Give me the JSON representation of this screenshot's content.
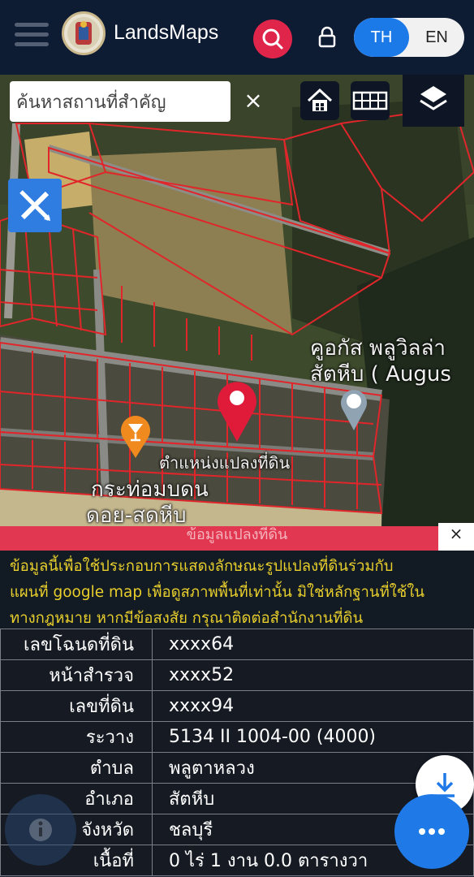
{
  "header": {
    "brand": "LandsMaps",
    "lang_th": "TH",
    "lang_en": "EN"
  },
  "map": {
    "search_placeholder": "ค้นหาสถานที่สำคัญ",
    "clear_label": "×",
    "place_name_line1": "คูอกัส พลูวิลล่า",
    "place_name_line2": "สัตหีบ ( Augus",
    "pin_label": "ตำแหน่งแปลงที่ดิน",
    "poi_line1": "กระท่อมบดน",
    "poi_line2": "ดอย-สดหีบ"
  },
  "panel": {
    "title": "ข้อมูลแปลงที่ดิน",
    "close_label": "×",
    "notice_lines": [
      "ข้อมูลนี้เพื่อใช้ประกอบการแสดงลักษณะรูปแปลงที่ดินร่วมกับ",
      "แผนที่ google map เพื่อดูสภาพพื้นที่เท่านั้น มิใช่หลักฐานที่ใช้ใน",
      "ทางกฎหมาย หากมีข้อสงสัย กรุณาติดต่อสำนักงานที่ดิน"
    ],
    "rows": [
      {
        "label": "เลขโฉนดที่ดิน",
        "value": "xxxx64"
      },
      {
        "label": "หน้าสำรวจ",
        "value": "xxxx52"
      },
      {
        "label": "เลขที่ดิน",
        "value": "xxxx94"
      },
      {
        "label": "ระวาง",
        "value": "5134 II 1004-00 (4000)"
      },
      {
        "label": "ตำบล",
        "value": "พลูตาหลวง"
      },
      {
        "label": "อำเภอ",
        "value": "สัตหีบ"
      },
      {
        "label": "จังหวัด",
        "value": "ชลบุรี"
      },
      {
        "label": "เนื้อที่",
        "value": "0 ไร่ 1 งาน 0.0 ตารางวา"
      }
    ]
  },
  "icons": {
    "menu": "hamburger-icon",
    "search": "search-icon",
    "lock": "lock-icon",
    "home": "home-icon",
    "grid": "grid-icon",
    "layers": "layers-icon",
    "tools": "ruler-pencil-icon",
    "pin": "map-pin-icon",
    "poi": "cocktail-icon",
    "download": "download-icon",
    "more": "more-dots-icon",
    "info": "info-icon"
  },
  "colors": {
    "header_bg": "#0d1b33",
    "accent_red": "#e0254a",
    "accent_blue": "#1c7ae8",
    "notice_text": "#e8cf2c",
    "parcel_lines": "#e0262a"
  }
}
